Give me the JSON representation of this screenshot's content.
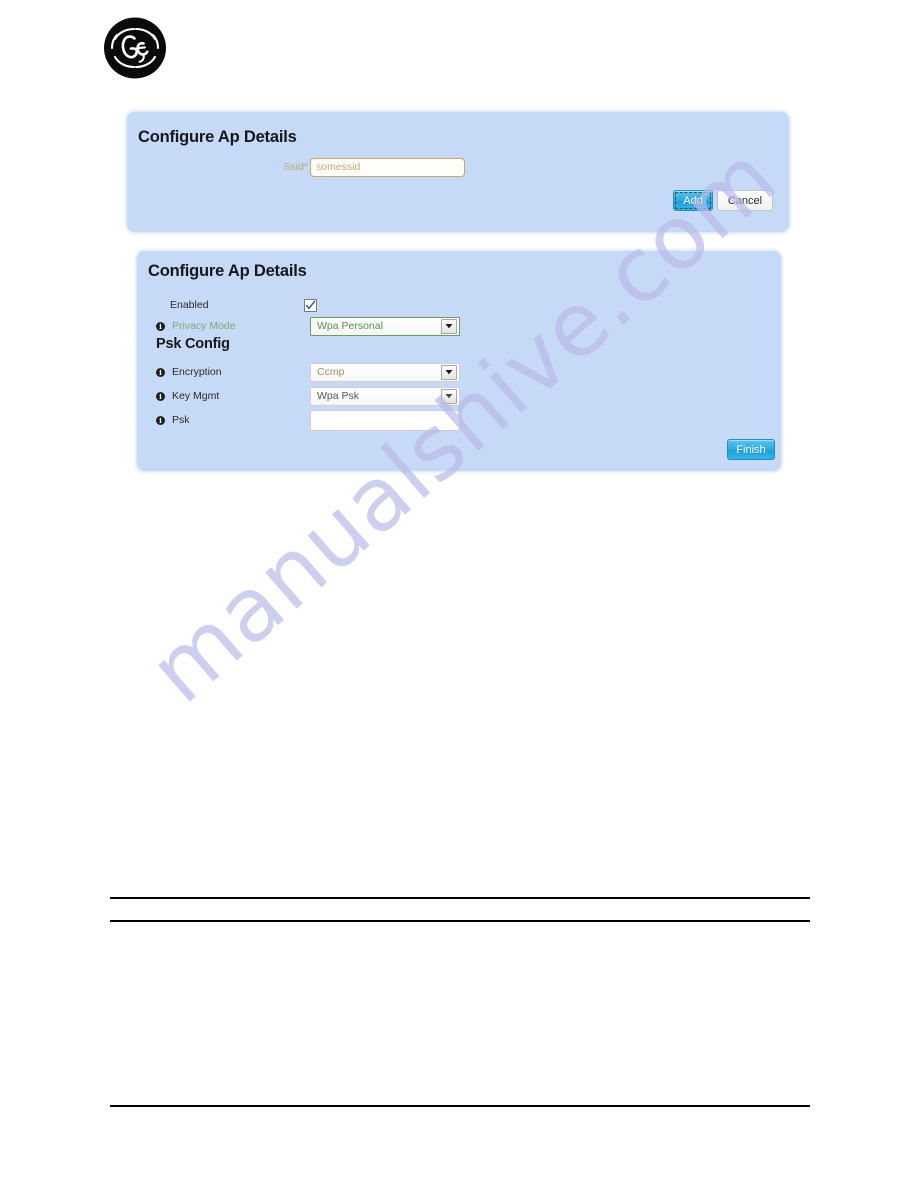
{
  "document": {
    "brand_logo_name": "ge-logo",
    "watermark_text": "manualshive.com",
    "watermark_color": "#b9bbe8"
  },
  "colors": {
    "panel_background": "#c6d9f7",
    "panel_border": "#dfeaf9",
    "primary_button": "#2aa8e0",
    "required_field": "#c8a86e",
    "validated_field": "#6a9e5f",
    "rule": "#000000"
  },
  "panel_one": {
    "title": "Configure Ap Details",
    "fields": [
      {
        "label": "Ssid",
        "required_marker": "*",
        "value": "somessid",
        "placeholder": "somessid",
        "type": "text"
      }
    ],
    "buttons": {
      "add_label": "Add",
      "cancel_label": "Cancel"
    }
  },
  "panel_two": {
    "title": "Configure Ap Details",
    "section_heading": "Psk Config",
    "fields": [
      {
        "label": "Enabled",
        "type": "checkbox",
        "checked": true,
        "has_info": false
      },
      {
        "label": "Privacy Mode",
        "type": "select",
        "value": "Wpa Personal",
        "has_info": true,
        "validated": true
      },
      {
        "label": "Encryption",
        "type": "select",
        "value": "Ccmp",
        "has_info": true,
        "validated": false
      },
      {
        "label": "Key Mgmt",
        "type": "select",
        "value": "Wpa Psk",
        "has_info": true,
        "validated": false
      },
      {
        "label": "Psk",
        "type": "text",
        "value": "",
        "placeholder": "",
        "has_info": true
      }
    ],
    "buttons": {
      "finish_label": "Finish"
    }
  },
  "icons": {
    "info": "i",
    "dropdown_arrow": "chevron-down-icon",
    "checkmark": "check-icon"
  }
}
